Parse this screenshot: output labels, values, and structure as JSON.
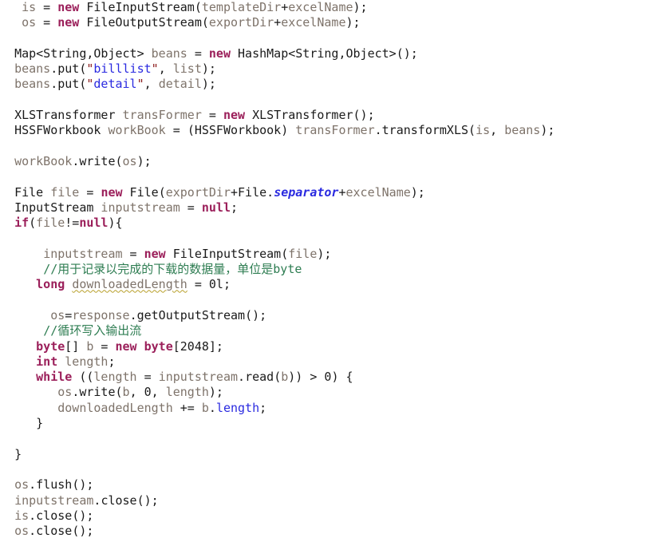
{
  "editor": {
    "language": "java",
    "background_color": "#ffffff",
    "font_size_px": 15,
    "line_height_px": 19.3
  },
  "colors": {
    "plain_variable": "#7e736a",
    "type_name": "#1a1a1a",
    "keyword": "#9b1f5a",
    "string_literal": "#2a2ae0",
    "string_quote": "#8b1a1a",
    "field_access": "#2a2ae0",
    "static_field": "#2a2ae0",
    "comment": "#2e7d52",
    "warning_underline": "#b8a02a"
  },
  "lines": [
    {
      "n": 1,
      "indent": 3,
      "text": "is = new FileInputStream(templateDir+excelName);"
    },
    {
      "n": 2,
      "indent": 3,
      "text": "os = new FileOutputStream(exportDir+excelName);"
    },
    {
      "n": 3,
      "indent": 0,
      "text": ""
    },
    {
      "n": 4,
      "indent": 2,
      "text": "Map<String,Object> beans = new HashMap<String,Object>();"
    },
    {
      "n": 5,
      "indent": 2,
      "text": "beans.put(\"billlist\", list);"
    },
    {
      "n": 6,
      "indent": 2,
      "text": "beans.put(\"detail\", detail);"
    },
    {
      "n": 7,
      "indent": 0,
      "text": ""
    },
    {
      "n": 8,
      "indent": 2,
      "text": "XLSTransformer transFormer = new XLSTransformer();"
    },
    {
      "n": 9,
      "indent": 2,
      "text": "HSSFWorkbook workBook = (HSSFWorkbook) transFormer.transformXLS(is, beans);"
    },
    {
      "n": 10,
      "indent": 0,
      "text": ""
    },
    {
      "n": 11,
      "indent": 2,
      "text": "workBook.write(os);"
    },
    {
      "n": 12,
      "indent": 0,
      "text": ""
    },
    {
      "n": 13,
      "indent": 2,
      "text": "File file = new File(exportDir+File.separator+excelName);"
    },
    {
      "n": 14,
      "indent": 2,
      "text": "InputStream inputstream = null;"
    },
    {
      "n": 15,
      "indent": 2,
      "text": "if(file!=null){"
    },
    {
      "n": 16,
      "indent": 0,
      "text": ""
    },
    {
      "n": 17,
      "indent": 6,
      "text": "inputstream = new FileInputStream(file);"
    },
    {
      "n": 18,
      "indent": 6,
      "text": "//用于记录以完成的下载的数据量，单位是byte"
    },
    {
      "n": 19,
      "indent": 5,
      "text": "long downloadedLength = 0l;"
    },
    {
      "n": 20,
      "indent": 0,
      "text": ""
    },
    {
      "n": 21,
      "indent": 7,
      "text": "os=response.getOutputStream();"
    },
    {
      "n": 22,
      "indent": 6,
      "text": "//循环写入输出流"
    },
    {
      "n": 23,
      "indent": 5,
      "text": "byte[] b = new byte[2048];"
    },
    {
      "n": 24,
      "indent": 5,
      "text": "int length;"
    },
    {
      "n": 25,
      "indent": 5,
      "text": "while ((length = inputstream.read(b)) > 0) {"
    },
    {
      "n": 26,
      "indent": 8,
      "text": "os.write(b, 0, length);"
    },
    {
      "n": 27,
      "indent": 8,
      "text": "downloadedLength += b.length;"
    },
    {
      "n": 28,
      "indent": 5,
      "text": "}"
    },
    {
      "n": 29,
      "indent": 0,
      "text": ""
    },
    {
      "n": 30,
      "indent": 2,
      "text": "}"
    },
    {
      "n": 31,
      "indent": 0,
      "text": ""
    },
    {
      "n": 32,
      "indent": 2,
      "text": "os.flush();"
    },
    {
      "n": 33,
      "indent": 2,
      "text": "inputstream.close();"
    },
    {
      "n": 34,
      "indent": 2,
      "text": "is.close();"
    },
    {
      "n": 35,
      "indent": 2,
      "text": "os.close();"
    }
  ],
  "tokens": {
    "l1": {
      "ws": "   ",
      "var_is": "is",
      "eq": " = ",
      "kw_new": "new",
      "sp": " ",
      "type": "FileInputStream",
      "paren_open": "(",
      "arg1": "templateDir",
      "plus": "+",
      "arg2": "excelName",
      "tail": ");"
    },
    "l2": {
      "ws": "   ",
      "var_os": "os",
      "eq": " = ",
      "kw_new": "new",
      "sp": " ",
      "type": "FileOutputStream",
      "paren_open": "(",
      "arg1": "exportDir",
      "plus": "+",
      "arg2": "excelName",
      "tail": ");"
    },
    "l4": {
      "ws": "  ",
      "type1": "Map<String,Object>",
      "var": " beans",
      "eq": " = ",
      "kw_new": "new",
      "type2": " HashMap<String,Object>",
      "tail": "();"
    },
    "l5": {
      "ws": "  ",
      "obj": "beans",
      "dot_put": ".put(",
      "q1": "\"",
      "str": "billlist",
      "q2": "\"",
      "comma": ", ",
      "arg": "list",
      "tail": ");"
    },
    "l6": {
      "ws": "  ",
      "obj": "beans",
      "dot_put": ".put(",
      "q1": "\"",
      "str": "detail",
      "q2": "\"",
      "comma": ", ",
      "arg": "detail",
      "tail": ");"
    },
    "l8": {
      "ws": "  ",
      "type1": "XLSTransformer",
      "var": " transFormer",
      "eq": " = ",
      "kw_new": "new",
      "type2": " XLSTransformer",
      "tail": "();"
    },
    "l9": {
      "ws": "  ",
      "type1": "HSSFWorkbook",
      "var": " workBook",
      "eq": " = ",
      "cast": "(HSSFWorkbook)",
      "obj": " transFormer",
      "dot": ".",
      "method": "transformXLS",
      "paren": "(",
      "a1": "is",
      "comma": ", ",
      "a2": "beans",
      "tail": ");"
    },
    "l11": {
      "ws": "  ",
      "obj": "workBook",
      "dot": ".",
      "method": "write",
      "paren": "(",
      "arg": "os",
      "tail": ");"
    },
    "l13": {
      "ws": "  ",
      "type1": "File",
      "var": " file",
      "eq": " = ",
      "kw_new": "new",
      "type2": " File",
      "paren": "(",
      "a1": "exportDir",
      "plus1": "+",
      "cls": "File",
      "dot": ".",
      "static_field": "separator",
      "plus2": "+",
      "a2": "excelName",
      "tail": ");"
    },
    "l14": {
      "ws": "  ",
      "type1": "InputStream",
      "var": " inputstream",
      "eq": " = ",
      "kw_null": "null",
      "tail": ";"
    },
    "l15": {
      "ws": "  ",
      "kw_if": "if",
      "paren": "(",
      "var": "file",
      "op": "!=",
      "kw_null": "null",
      "tail": "){"
    },
    "l17": {
      "ws": "      ",
      "var": "inputstream",
      "eq": " = ",
      "kw_new": "new",
      "type": " FileInputStream",
      "paren": "(",
      "arg": "file",
      "tail": ");"
    },
    "l18": {
      "ws": "      ",
      "comment": "//",
      "comment_cjk": "用于记录以完成的下载的数据量，单位是",
      "comment_latin": "byte"
    },
    "l19": {
      "ws": "     ",
      "kw_long": "long",
      "sp": " ",
      "var_warn": "downloadedLength",
      "eq": " = ",
      "num": "0l",
      "tail": ";"
    },
    "l21": {
      "ws": "       ",
      "var": "os",
      "eq": "=",
      "obj": "response",
      "dot": ".",
      "method": "getOutputStream",
      "tail": "();"
    },
    "l22": {
      "ws": "      ",
      "comment": "//",
      "comment_cjk": "循环写入输出流"
    },
    "l23": {
      "ws": "     ",
      "kw_byte": "byte",
      "brackets": "[]",
      "var": " b",
      "eq": " = ",
      "kw_new": "new",
      "sp": " ",
      "kw_byte2": "byte",
      "arr_open": "[",
      "num": "2048",
      "tail": "];"
    },
    "l24": {
      "ws": "     ",
      "kw_int": "int",
      "var": " length",
      "tail": ";"
    },
    "l25": {
      "ws": "     ",
      "kw_while": "while",
      "open": " ((",
      "var1": "length",
      "eq": " = ",
      "obj": "inputstream",
      "dot": ".",
      "method": "read",
      "paren": "(",
      "arg": "b",
      "close": "))",
      "op": " > ",
      "num": "0",
      "tail": ") {"
    },
    "l26": {
      "ws": "        ",
      "obj": "os",
      "dot": ".",
      "method": "write",
      "paren": "(",
      "a1": "b",
      "c1": ", ",
      "num": "0",
      "c2": ", ",
      "a2": "length",
      "tail": ");"
    },
    "l27": {
      "ws": "        ",
      "var": "downloadedLength",
      "op": " += ",
      "obj": "b",
      "dot": ".",
      "field": "length",
      "tail": ";"
    },
    "l28": {
      "ws": "     ",
      "brace": "}"
    },
    "l30": {
      "ws": "  ",
      "brace": "}"
    },
    "l32": {
      "ws": "  ",
      "obj": "os",
      "dot": ".",
      "method": "flush",
      "tail": "();"
    },
    "l33": {
      "ws": "  ",
      "obj": "inputstream",
      "dot": ".",
      "method": "close",
      "tail": "();"
    },
    "l34": {
      "ws": "  ",
      "obj": "is",
      "dot": ".",
      "method": "close",
      "tail": "();"
    },
    "l35": {
      "ws": "  ",
      "obj": "os",
      "dot": ".",
      "method": "close",
      "tail": "();"
    }
  }
}
